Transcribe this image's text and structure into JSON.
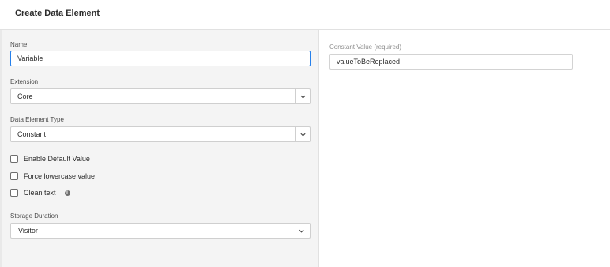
{
  "header": {
    "title": "Create Data Element"
  },
  "form": {
    "name": {
      "label": "Name",
      "value": "Variable"
    },
    "extension": {
      "label": "Extension",
      "value": "Core"
    },
    "type": {
      "label": "Data Element Type",
      "value": "Constant"
    },
    "checkboxes": [
      {
        "label": "Enable Default Value",
        "checked": false
      },
      {
        "label": "Force lowercase value",
        "checked": false
      },
      {
        "label": "Clean text",
        "checked": false
      }
    ],
    "storage": {
      "label": "Storage Duration",
      "value": "Visitor"
    }
  },
  "settings": {
    "constant_label": "Constant Value (required)",
    "constant_value": "valueToBeReplaced"
  },
  "colors": {
    "focus": "#2680eb",
    "panel": "#f4f4f4"
  },
  "icons": [
    "chevron-down-icon",
    "info-icon"
  ]
}
